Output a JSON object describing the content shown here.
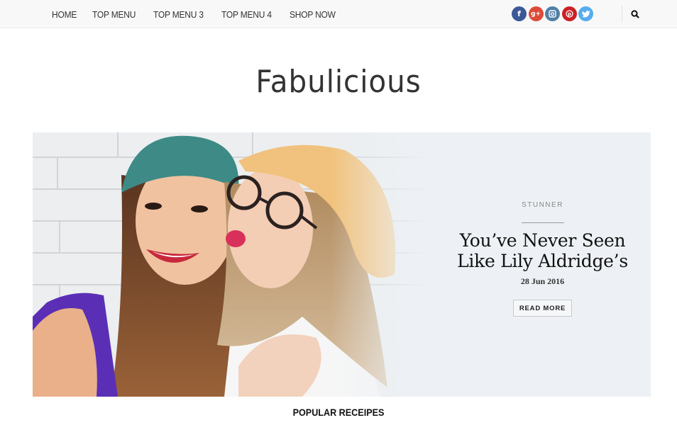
{
  "nav": {
    "items": [
      {
        "label": "HOME"
      },
      {
        "label": "TOP MENU"
      },
      {
        "label": "TOP MENU 3"
      },
      {
        "label": "TOP MENU 4"
      },
      {
        "label": "SHOP NOW"
      }
    ]
  },
  "social": {
    "items": [
      {
        "name": "facebook",
        "glyph": "f",
        "color": "#3b5998"
      },
      {
        "name": "google-plus",
        "glyph": "g+",
        "color": "#dd4b39"
      },
      {
        "name": "instagram",
        "glyph": "◙",
        "color": "#517fa4"
      },
      {
        "name": "pinterest",
        "glyph": "P",
        "color": "#cb2027"
      },
      {
        "name": "twitter",
        "glyph": "t",
        "color": "#55acee"
      }
    ]
  },
  "header": {
    "logo": "Fabulicious"
  },
  "hero": {
    "category": "STUNNER",
    "title_line1": "You’ve Never Seen",
    "title_line2": "Like Lily Aldridge’s",
    "date": "28 Jun 2016",
    "read_more_label": "READ MORE",
    "image_alt": "Two young women in knit beanies taking a selfie"
  },
  "section": {
    "title": "POPULAR RECEIPES"
  }
}
